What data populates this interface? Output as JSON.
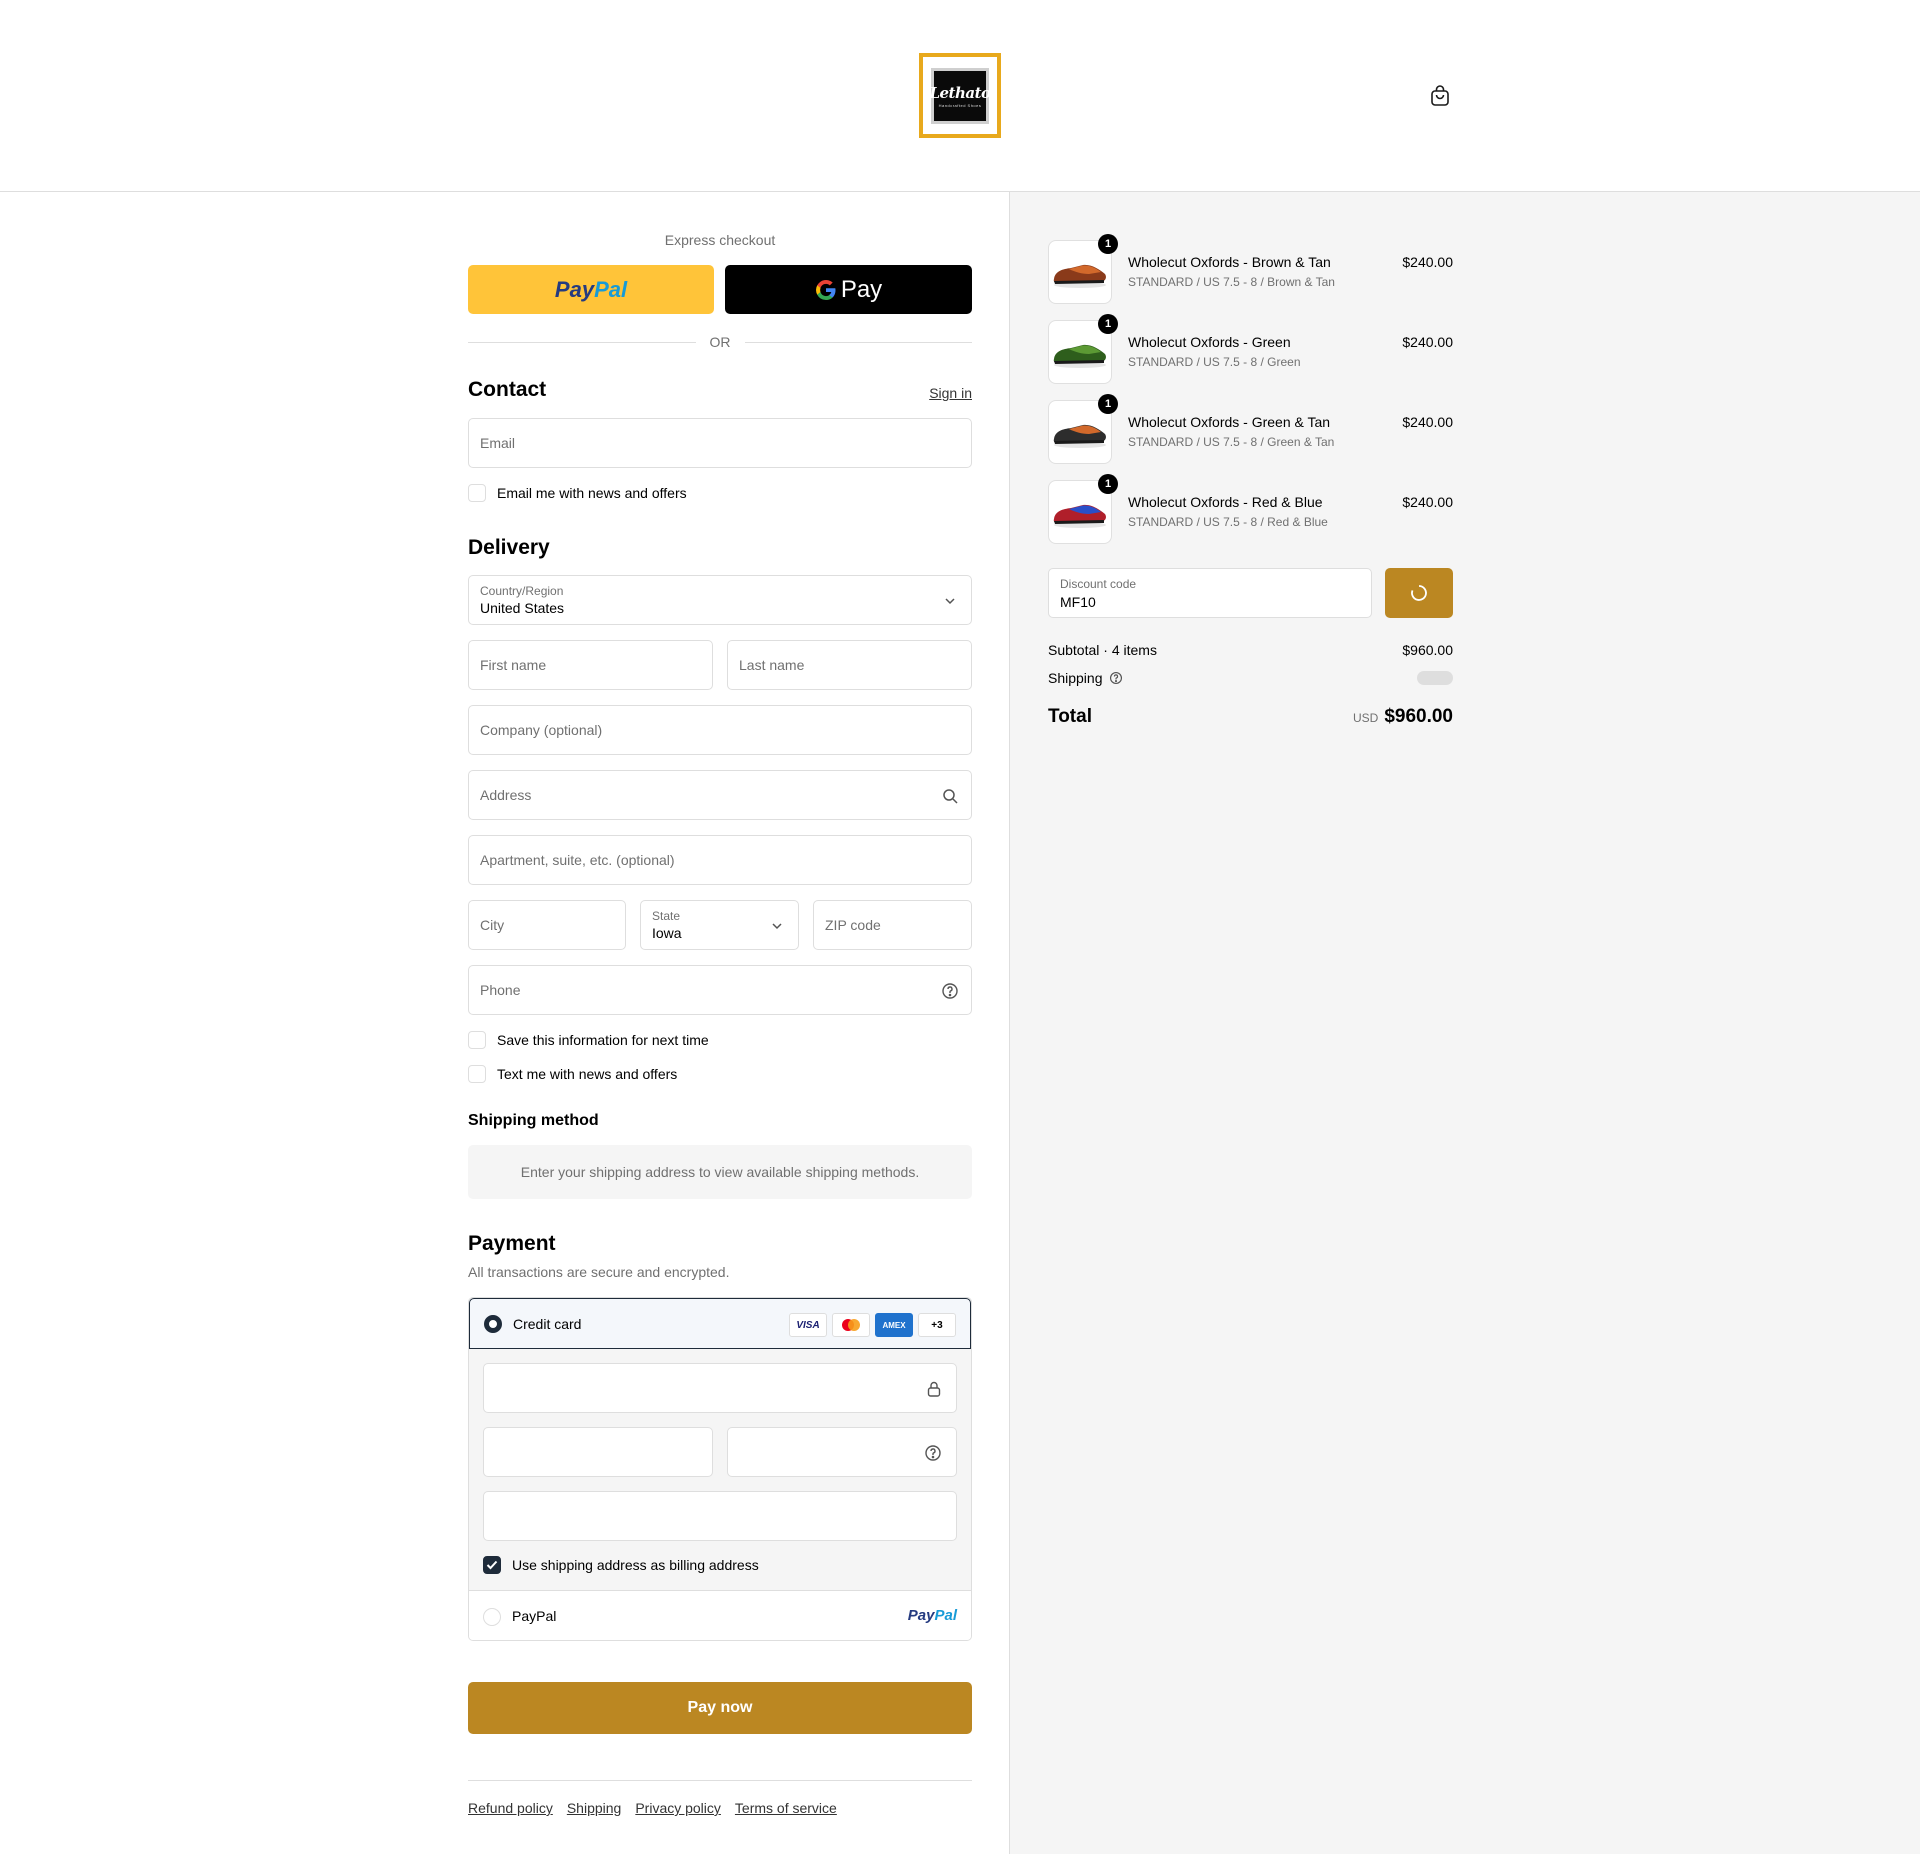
{
  "header": {
    "logo_text": "Lethato",
    "logo_subtext": "Handcrafted Shoes",
    "cart_icon": "shopping-bag-icon"
  },
  "express": {
    "label": "Express checkout",
    "paypal_part1": "Pay",
    "paypal_part2": "Pal",
    "gpay_label": "Pay",
    "or": "OR"
  },
  "contact": {
    "title": "Contact",
    "sign_in": "Sign in",
    "email_placeholder": "Email",
    "news_offers": "Email me with news and offers"
  },
  "delivery": {
    "title": "Delivery",
    "country_label": "Country/Region",
    "country_value": "United States",
    "first_name": "First name",
    "last_name": "Last name",
    "company": "Company (optional)",
    "address": "Address",
    "apartment": "Apartment, suite, etc. (optional)",
    "city": "City",
    "state_label": "State",
    "state_value": "Iowa",
    "zip": "ZIP code",
    "phone": "Phone",
    "save_info": "Save this information for next time",
    "text_offers": "Text me with news and offers"
  },
  "shipping_method": {
    "title": "Shipping method",
    "info": "Enter your shipping address to view available shipping methods."
  },
  "payment": {
    "title": "Payment",
    "subtitle": "All transactions are secure and encrypted.",
    "credit_card": "Credit card",
    "cards": [
      "VISA",
      "AMEX",
      "+3"
    ],
    "billing_same": "Use shipping address as billing address",
    "paypal": "PayPal",
    "paypal_logo1": "Pay",
    "paypal_logo2": "Pal",
    "pay_now": "Pay now"
  },
  "footer": {
    "links": [
      "Refund policy",
      "Shipping",
      "Privacy policy",
      "Terms of service"
    ]
  },
  "order": {
    "items": [
      {
        "qty": "1",
        "title": "Wholecut Oxfords - Brown & Tan",
        "variant": "STANDARD / US 7.5 - 8 / Brown & Tan",
        "price": "$240.00",
        "color_a": "#8a3a1a",
        "color_b": "#d2692b"
      },
      {
        "qty": "1",
        "title": "Wholecut Oxfords - Green",
        "variant": "STANDARD / US 7.5 - 8 / Green",
        "price": "$240.00",
        "color_a": "#2e5e1c",
        "color_b": "#5c9a34"
      },
      {
        "qty": "1",
        "title": "Wholecut Oxfords - Green & Tan",
        "variant": "STANDARD / US 7.5 - 8 / Green & Tan",
        "price": "$240.00",
        "color_a": "#2d2d2d",
        "color_b": "#d2692b"
      },
      {
        "qty": "1",
        "title": "Wholecut Oxfords - Red & Blue",
        "variant": "STANDARD / US 7.5 - 8 / Red & Blue",
        "price": "$240.00",
        "color_a": "#b01f2a",
        "color_b": "#2a4fc9"
      }
    ],
    "discount_label": "Discount code",
    "discount_value": "MF10",
    "subtotal_label": "Subtotal · 4 items",
    "subtotal_value": "$960.00",
    "shipping_label": "Shipping",
    "total_label": "Total",
    "currency": "USD",
    "total_value": "$960.00"
  },
  "colors": {
    "accent": "#bb8722",
    "paypal_yellow": "#ffc439",
    "dark": "#1e2b3a"
  }
}
